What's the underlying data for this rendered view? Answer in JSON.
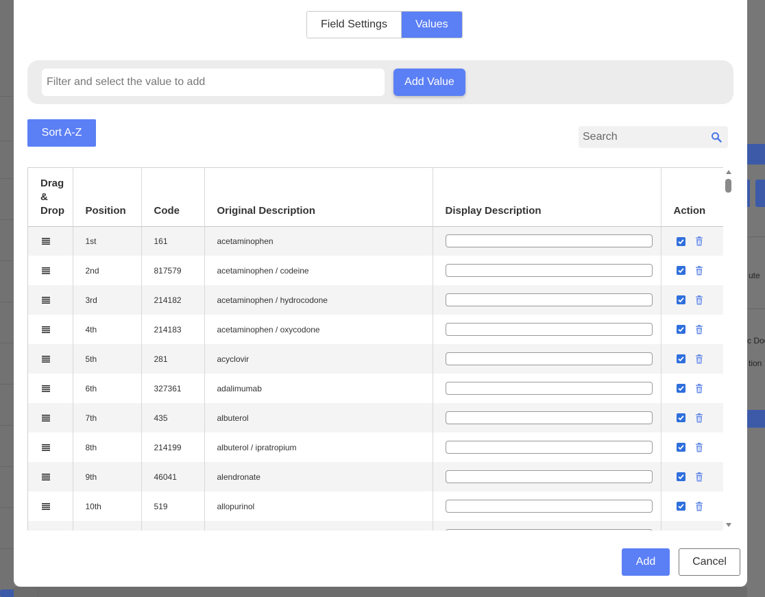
{
  "tabs": [
    {
      "label": "Field Settings",
      "active": false
    },
    {
      "label": "Values",
      "active": true
    }
  ],
  "filter": {
    "placeholder": "Filter and select the value to add",
    "add_label": "Add Value"
  },
  "sort_label": "Sort A-Z",
  "search": {
    "placeholder": "Search"
  },
  "table": {
    "headers": {
      "drag": [
        "Drag",
        "&",
        "Drop"
      ],
      "position": "Position",
      "code": "Code",
      "original": "Original Description",
      "display": "Display Description",
      "action": "Action"
    },
    "rows": [
      {
        "position": "1st",
        "code": "161",
        "original": "acetaminophen",
        "display": "",
        "checked": true
      },
      {
        "position": "2nd",
        "code": "817579",
        "original": "acetaminophen / codeine",
        "display": "",
        "checked": true
      },
      {
        "position": "3rd",
        "code": "214182",
        "original": "acetaminophen / hydrocodone",
        "display": "",
        "checked": true
      },
      {
        "position": "4th",
        "code": "214183",
        "original": "acetaminophen / oxycodone",
        "display": "",
        "checked": true
      },
      {
        "position": "5th",
        "code": "281",
        "original": "acyclovir",
        "display": "",
        "checked": true
      },
      {
        "position": "6th",
        "code": "327361",
        "original": "adalimumab",
        "display": "",
        "checked": true
      },
      {
        "position": "7th",
        "code": "435",
        "original": "albuterol",
        "display": "",
        "checked": true
      },
      {
        "position": "8th",
        "code": "214199",
        "original": "albuterol / ipratropium",
        "display": "",
        "checked": true
      },
      {
        "position": "9th",
        "code": "46041",
        "original": "alendronate",
        "display": "",
        "checked": true
      },
      {
        "position": "10th",
        "code": "519",
        "original": "allopurinol",
        "display": "",
        "checked": true
      },
      {
        "position": "",
        "code": "",
        "original": "",
        "display": "",
        "checked": true
      }
    ]
  },
  "footer": {
    "add_label": "Add",
    "cancel_label": "Cancel"
  },
  "background": {
    "fragments": [
      "ute",
      "c Doc",
      "tion"
    ]
  },
  "colors": {
    "primary": "#5b7ff5",
    "checkbox": "#2f6fdc",
    "row_alt": "#f4f4f4",
    "filter_bar": "#ececec",
    "overlay": "#7a7a7a"
  }
}
